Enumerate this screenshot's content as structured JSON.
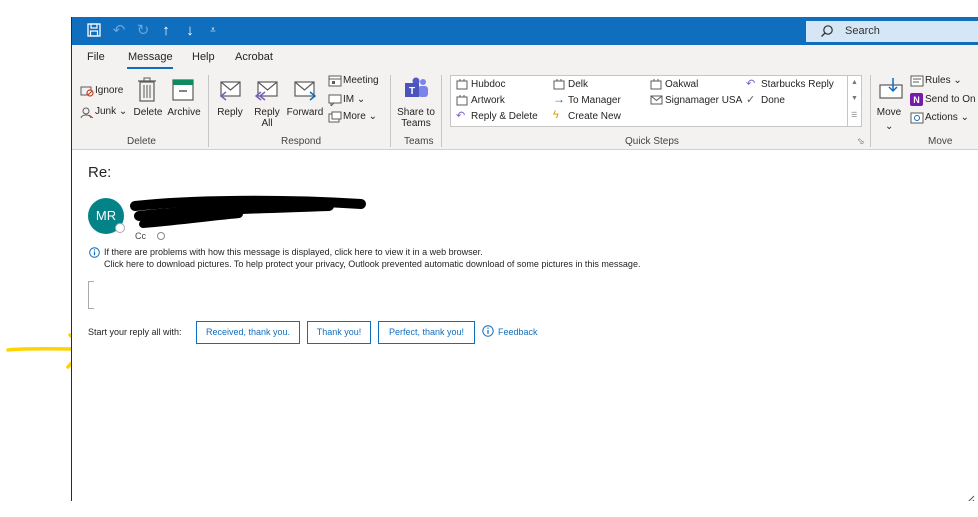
{
  "titlebar": {
    "icons": [
      "save-icon",
      "undo-icon",
      "redo-icon",
      "up-arrow-icon",
      "down-arrow-icon",
      "customize-quick-access-icon"
    ],
    "search_placeholder": "Search"
  },
  "tabs": [
    "File",
    "Message",
    "Help",
    "Acrobat"
  ],
  "active_tab": "Message",
  "ribbon": {
    "delete_group": {
      "label": "Delete",
      "ignore": "Ignore",
      "junk": "Junk",
      "delete": "Delete",
      "archive": "Archive"
    },
    "respond_group": {
      "label": "Respond",
      "reply": "Reply",
      "reply_all_1": "Reply",
      "reply_all_2": "All",
      "forward": "Forward",
      "meeting": "Meeting",
      "im": "IM",
      "more": "More"
    },
    "teams_group": {
      "label": "Teams",
      "share_1": "Share to",
      "share_2": "Teams"
    },
    "quick_steps": {
      "label": "Quick Steps",
      "items": [
        "Hubdoc",
        "Artwork",
        "Reply & Delete",
        "Delk",
        "To Manager",
        "Create New",
        "Oakwal",
        "Signamager USA",
        "Starbucks Reply",
        "Done"
      ]
    },
    "move_group": {
      "label": "Move",
      "move": "Move",
      "rules": "Rules",
      "send_to": "Send to On",
      "actions": "Actions"
    }
  },
  "message": {
    "subject": "Re:",
    "avatar_initials": "MR",
    "cc_label": "Cc",
    "info_line_1": "If there are problems with how this message is displayed, click here to view it in a web browser.",
    "info_line_2": "Click here to download pictures. To help protect your privacy, Outlook prevented automatic download of some pictures in this message.",
    "reply_prompt": "Start your reply all with:",
    "suggested_replies": [
      "Received, thank you.",
      "Thank you!",
      "Perfect, thank you!"
    ],
    "feedback": "Feedback"
  },
  "colors": {
    "titlebar": "#106ebe",
    "ribbon": "#f3f2f1",
    "avatar": "#038387",
    "link": "#106ebe",
    "annotation": "#ffd400"
  }
}
